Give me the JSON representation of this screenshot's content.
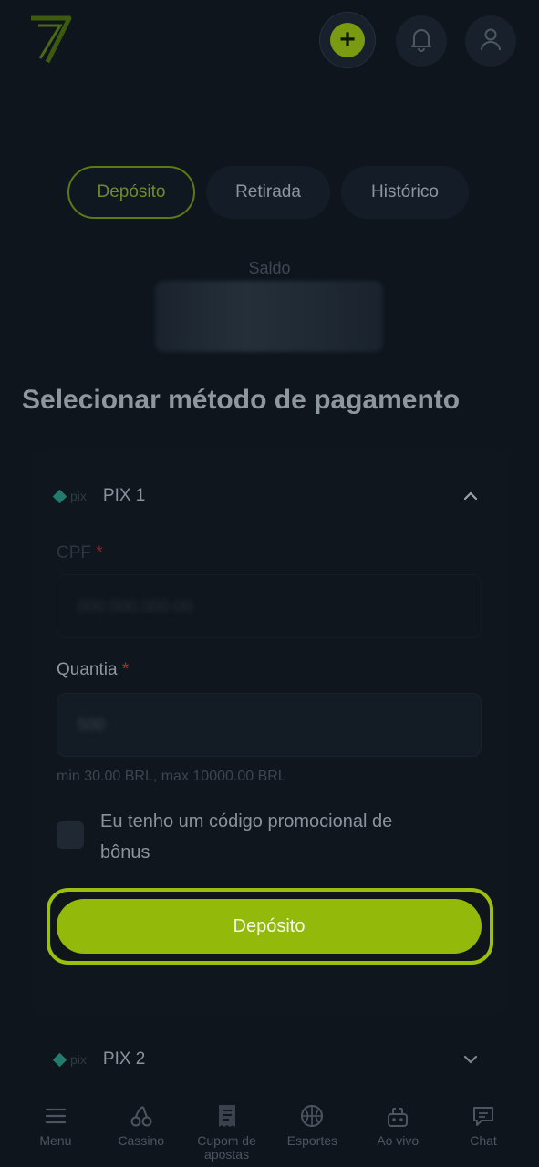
{
  "header": {
    "logo_icon": "seven-logo-icon",
    "add_funds_icon": "plus-icon",
    "notifications_icon": "bell-icon",
    "profile_icon": "user-icon",
    "plus_symbol": "+"
  },
  "tabs": [
    {
      "label": "Depósito",
      "active": true
    },
    {
      "label": "Retirada",
      "active": false
    },
    {
      "label": "Histórico",
      "active": false
    }
  ],
  "balance": {
    "label": "Saldo"
  },
  "section_title": "Selecionar método de pagamento",
  "methods": [
    {
      "logo_text": "pix",
      "name": "PIX 1",
      "expanded": true
    },
    {
      "logo_text": "pix",
      "name": "PIX 2",
      "expanded": false
    }
  ],
  "form": {
    "cpf_label": "CPF",
    "cpf_value": "000.000.000-00",
    "required_mark": "*",
    "amount_label": "Quantia",
    "amount_value": "500",
    "limits_hint": "min 30.00 BRL, max 10000.00 BRL",
    "promo_checkbox_label": "Eu tenho um código promocional de bônus",
    "submit_label": "Depósito"
  },
  "bottom_nav": [
    {
      "label": "Menu",
      "icon": "menu-icon"
    },
    {
      "label": "Cassino",
      "icon": "cherries-icon"
    },
    {
      "label": "Cupom de apostas",
      "icon": "receipt-icon"
    },
    {
      "label": "Esportes",
      "icon": "basketball-icon"
    },
    {
      "label": "Ao vivo",
      "icon": "live-icon"
    },
    {
      "label": "Chat",
      "icon": "chat-icon"
    }
  ],
  "colors": {
    "background": "#0e151d",
    "accent": "#93b90a",
    "accent_outline": "#9cbf0f"
  }
}
